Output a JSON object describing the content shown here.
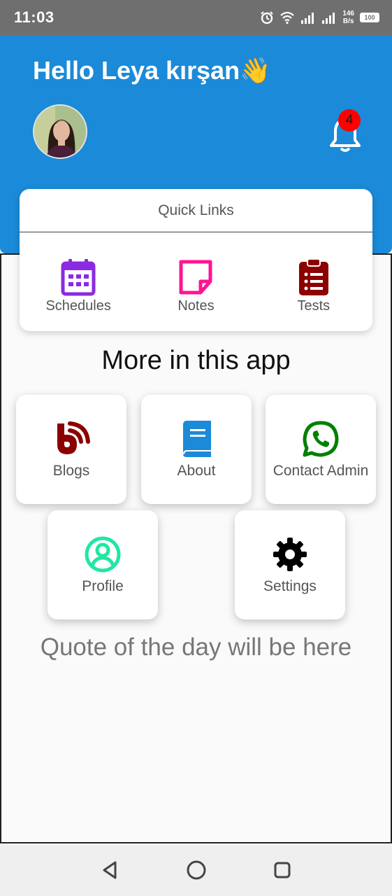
{
  "status_bar": {
    "time": "11:03",
    "net_speed_value": "146",
    "net_speed_unit": "B/s",
    "battery": "100",
    "icons": [
      "alarm-icon",
      "wifi-icon",
      "signal-icon",
      "signal-icon",
      "battery-icon"
    ]
  },
  "header": {
    "greeting": "Hello Leya kırşan👋",
    "notification_count": "4",
    "accent_color": "#1b8ad8"
  },
  "quick_links": {
    "title": "Quick Links",
    "items": [
      {
        "label": "Schedules",
        "icon": "calendar-icon",
        "color": "#8a2be2"
      },
      {
        "label": "Notes",
        "icon": "note-icon",
        "color": "#ff1493"
      },
      {
        "label": "Tests",
        "icon": "clipboard-list-icon",
        "color": "#8b0000"
      }
    ]
  },
  "more_section": {
    "title": "More in this app",
    "tiles": [
      {
        "label": "Blogs",
        "icon": "blog-icon",
        "color": "#8b0000"
      },
      {
        "label": "About",
        "icon": "book-icon",
        "color": "#1b8ad8"
      },
      {
        "label": "Contact Admin",
        "icon": "whatsapp-icon",
        "color": "#008000"
      },
      {
        "label": "Profile",
        "icon": "user-circle-icon",
        "color": "#1ee8a0"
      },
      {
        "label": "Settings",
        "icon": "gear-icon",
        "color": "#000000"
      }
    ]
  },
  "quote": "Quote of the day will be here",
  "nav_bar": {
    "buttons": [
      "back-icon",
      "home-icon",
      "recents-icon"
    ]
  }
}
